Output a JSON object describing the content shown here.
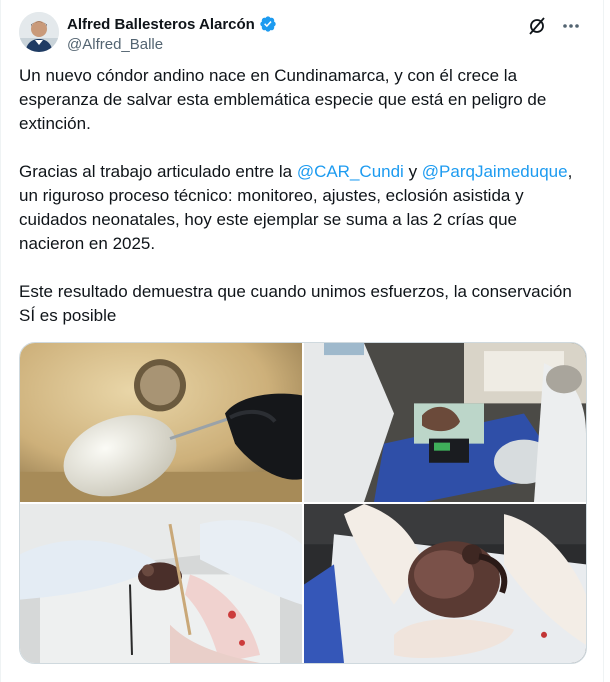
{
  "author": {
    "name": "Alfred Ballesteros Alarcón",
    "handle": "@Alfred_Balle",
    "verified_color": "#1d9bf0"
  },
  "icons": {
    "grok": "grok-icon",
    "more": "more-icon",
    "verified": "verified-badge-icon"
  },
  "tweet": {
    "p1": "Un nuevo cóndor andino nace en Cundinamarca, y con él crece la esperanza de salvar esta emblemática especie que está en peligro de extinción.",
    "p2_start": "Gracias al trabajo articulado entre la ",
    "mention1": "@CAR_Cundi",
    "p2_mid": " y ",
    "mention2": "@ParqJaimeduque",
    "p2_end": ", un riguroso proceso técnico: monitoreo, ajustes, eclosión asistida y cuidados neonatales, hoy este ejemplar se suma a las 2 crías que nacieron en 2025.",
    "p3": "Este resultado demuestra que cuando unimos esfuerzos, la conservación SÍ es posible"
  },
  "colors": {
    "link": "#1d9bf0",
    "text": "#0f1419",
    "secondary": "#536471"
  }
}
